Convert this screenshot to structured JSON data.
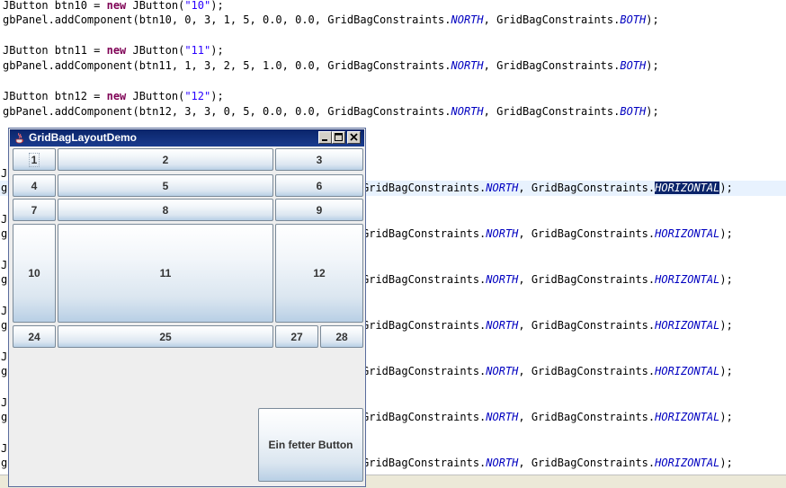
{
  "code_lines": {
    "l1_a": "JButton btn10 = ",
    "l1_kw": "new",
    "l1_b": " JButton(",
    "l1_str": "\"10\"",
    "l1_c": ");",
    "l2_a": "gbPanel.addComponent(btn10, 0, 3, 1, 5, 0.0, 0.0, GridBagConstraints.",
    "l2_c1": "NORTH",
    "l2_b": ", GridBagConstraints.",
    "l2_c2": "BOTH",
    "l2_e": ");",
    "l3_a": "JButton btn11 = ",
    "l3_kw": "new",
    "l3_b": " JButton(",
    "l3_str": "\"11\"",
    "l3_c": ");",
    "l4_a": "gbPanel.addComponent(btn11, 1, 3, 2, 5, 1.0, 0.0, GridBagConstraints.",
    "l4_c1": "NORTH",
    "l4_b": ", GridBagConstraints.",
    "l4_c2": "BOTH",
    "l4_e": ");",
    "l5_a": "JButton btn12 = ",
    "l5_kw": "new",
    "l5_b": " JButton(",
    "l5_str": "\"12\"",
    "l5_c": ");",
    "l6_a": "gbPanel.addComponent(btn12, 3, 3, 0, 5, 0.0, 0.0, GridBagConstraints.",
    "l6_c1": "NORTH",
    "l6_b": ", GridBagConstraints.",
    "l6_c2": "BOTH",
    "l6_e": ");",
    "partial_a": "GridBagConstraints.",
    "partial_c1": "NORTH",
    "partial_b": ", GridBagConstraints.",
    "partial_c2": "HORIZONTAL",
    "partial_e": ");",
    "left_j": "J",
    "left_g": "g"
  },
  "window": {
    "title": "GridBagLayoutDemo"
  },
  "buttons": {
    "b1": "1",
    "b2": "2",
    "b3": "3",
    "b4": "4",
    "b5": "5",
    "b6": "6",
    "b7": "7",
    "b8": "8",
    "b9": "9",
    "b10": "10",
    "b11": "11",
    "b12": "12",
    "b24": "24",
    "b25": "25",
    "b27": "27",
    "b28": "28",
    "fat": "Ein fetter Button"
  }
}
